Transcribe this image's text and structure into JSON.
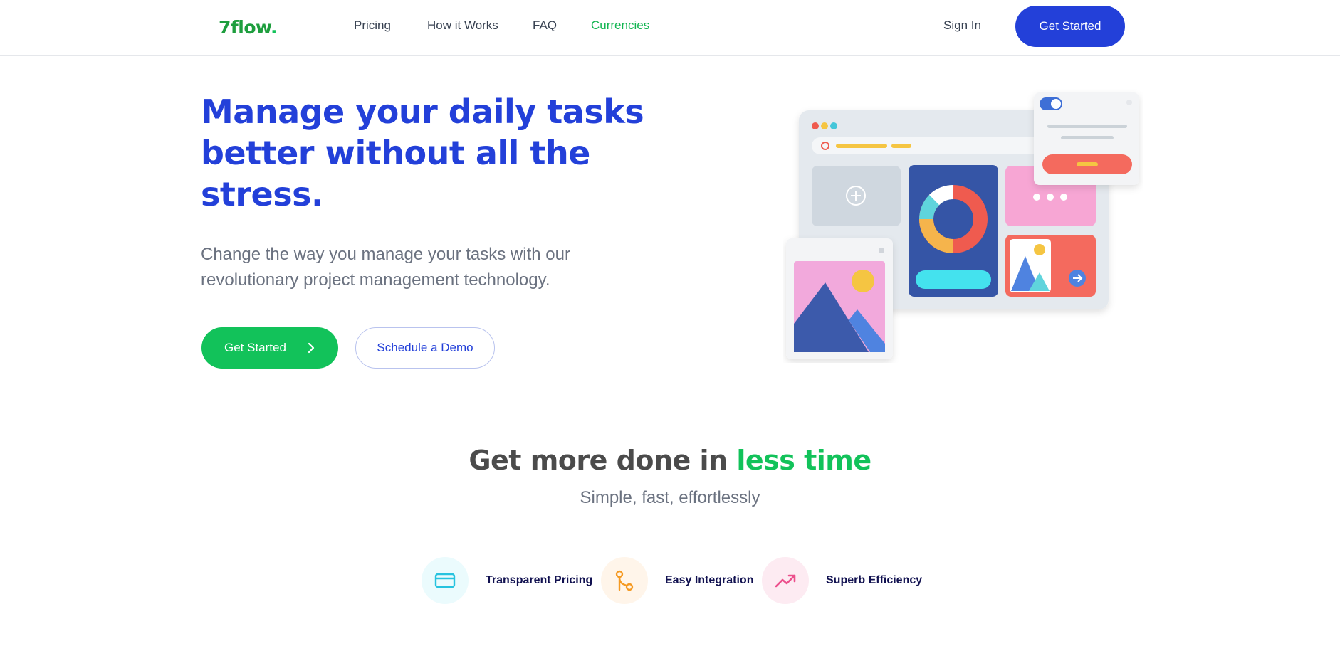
{
  "nav": {
    "logo": "7flow",
    "logo_dot": ".",
    "links": [
      "Pricing",
      "How it Works",
      "FAQ",
      "Currencies"
    ],
    "signin": "Sign In",
    "cta": "Get Started"
  },
  "hero": {
    "title": "Manage your daily tasks better without all the stress.",
    "subtitle": "Change the way you manage your tasks with our revolutionary project management technology.",
    "primary_button": "Get Started",
    "secondary_button": "Schedule a Demo"
  },
  "section": {
    "title_part1": "Get more done in ",
    "title_accent": "less time",
    "subtitle": "Simple, fast, effortlessly"
  },
  "features": [
    {
      "label": "Transparent Pricing",
      "icon": "credit-card-icon"
    },
    {
      "label": "Easy Integration",
      "icon": "git-merge-icon"
    },
    {
      "label": "Superb Efficiency",
      "icon": "trending-up-icon"
    }
  ],
  "colors": {
    "brand_blue": "#2340d9",
    "brand_green": "#12c25a"
  }
}
